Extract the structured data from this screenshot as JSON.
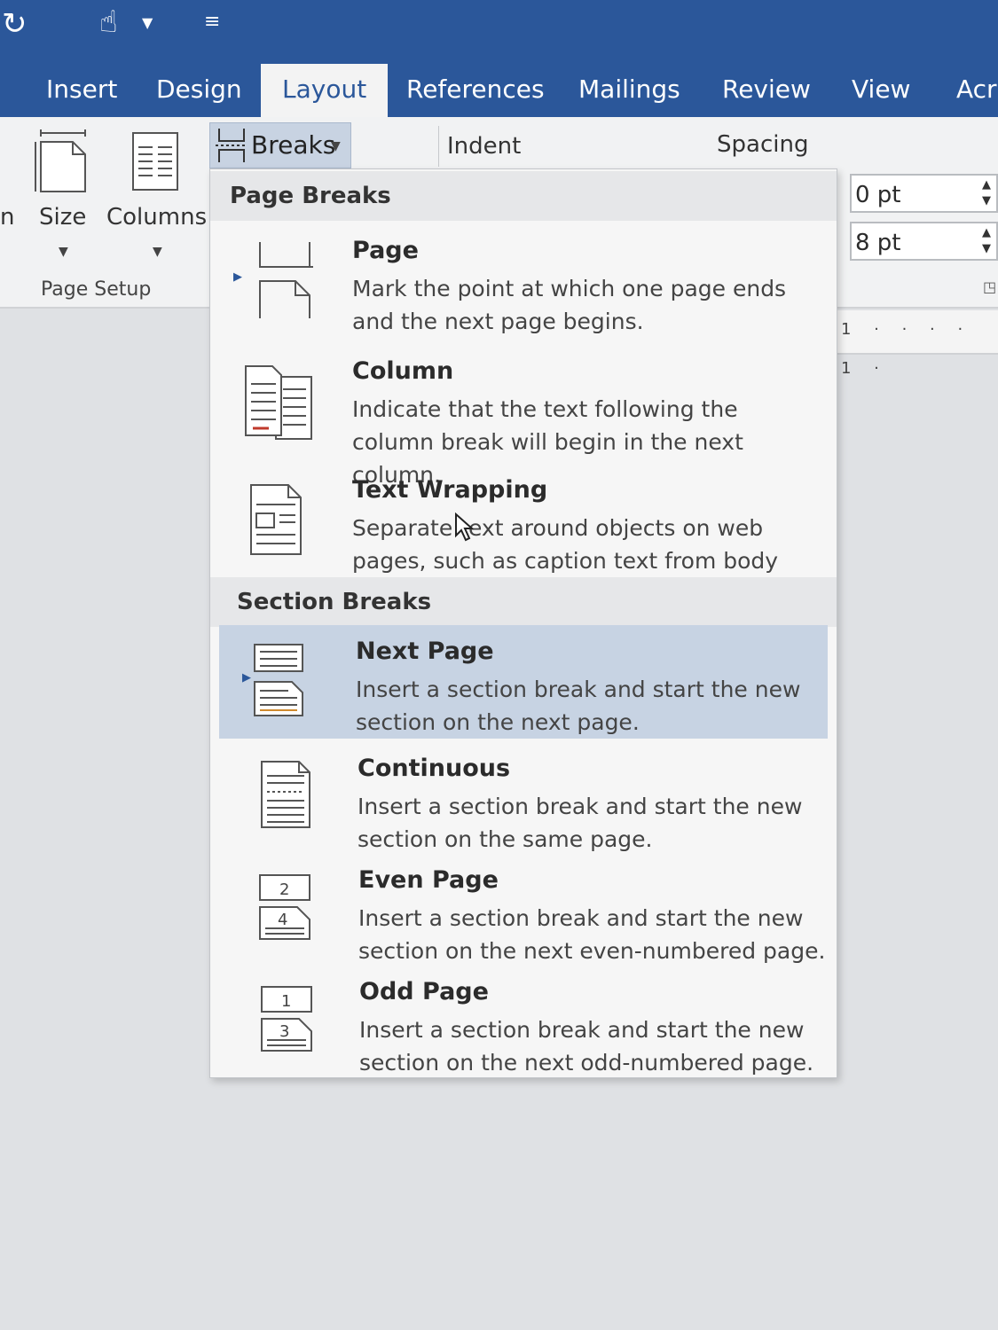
{
  "ribbon_tabs": [
    {
      "label": "Insert"
    },
    {
      "label": "Design"
    },
    {
      "label": "Layout"
    },
    {
      "label": "References"
    },
    {
      "label": "Mailings"
    },
    {
      "label": "Review"
    },
    {
      "label": "View"
    },
    {
      "label": "Acr"
    }
  ],
  "active_tab": "Layout",
  "quick_access": {
    "icons": [
      "redo-icon",
      "touch-mode-icon",
      "dropdown-caret-icon",
      "customize-toolbar-icon"
    ]
  },
  "page_setup": {
    "partial_label": "n",
    "size_label": "Size",
    "columns_label": "Columns",
    "group_label": "Page Setup"
  },
  "breaks_button": {
    "label": "Breaks"
  },
  "paragraph": {
    "indent_label": "Indent",
    "spacing_label": "Spacing",
    "spacing_before": "0 pt",
    "spacing_after": "8 pt"
  },
  "ruler": {
    "text": "1 · · · · 1 ·"
  },
  "menu": {
    "page_breaks_header": "Page Breaks",
    "section_breaks_header": "Section Breaks",
    "page_breaks": [
      {
        "title": "Page",
        "desc": "Mark the point at which one page ends and the next page begins."
      },
      {
        "title": "Column",
        "desc": "Indicate that the text following the column break will begin in the next column."
      },
      {
        "title": "Text Wrapping",
        "desc": "Separate text around objects on web pages, such as caption text from body text."
      }
    ],
    "section_breaks": [
      {
        "title": "Next Page",
        "desc": "Insert a section break and start the new section on the next page."
      },
      {
        "title": "Continuous",
        "desc": "Insert a section break and start the new section on the same page."
      },
      {
        "title": "Even Page",
        "desc": "Insert a section break and start the new section on the next even-numbered page."
      },
      {
        "title": "Odd Page",
        "desc": "Insert a section break and start the new section on the next odd-numbered page."
      }
    ],
    "icon_numbers": {
      "even_top": "2",
      "even_bottom": "4",
      "odd_top": "1",
      "odd_bottom": "3"
    }
  },
  "colors": {
    "ribbon_blue": "#2b579a",
    "highlight": "#c7d3e3"
  }
}
